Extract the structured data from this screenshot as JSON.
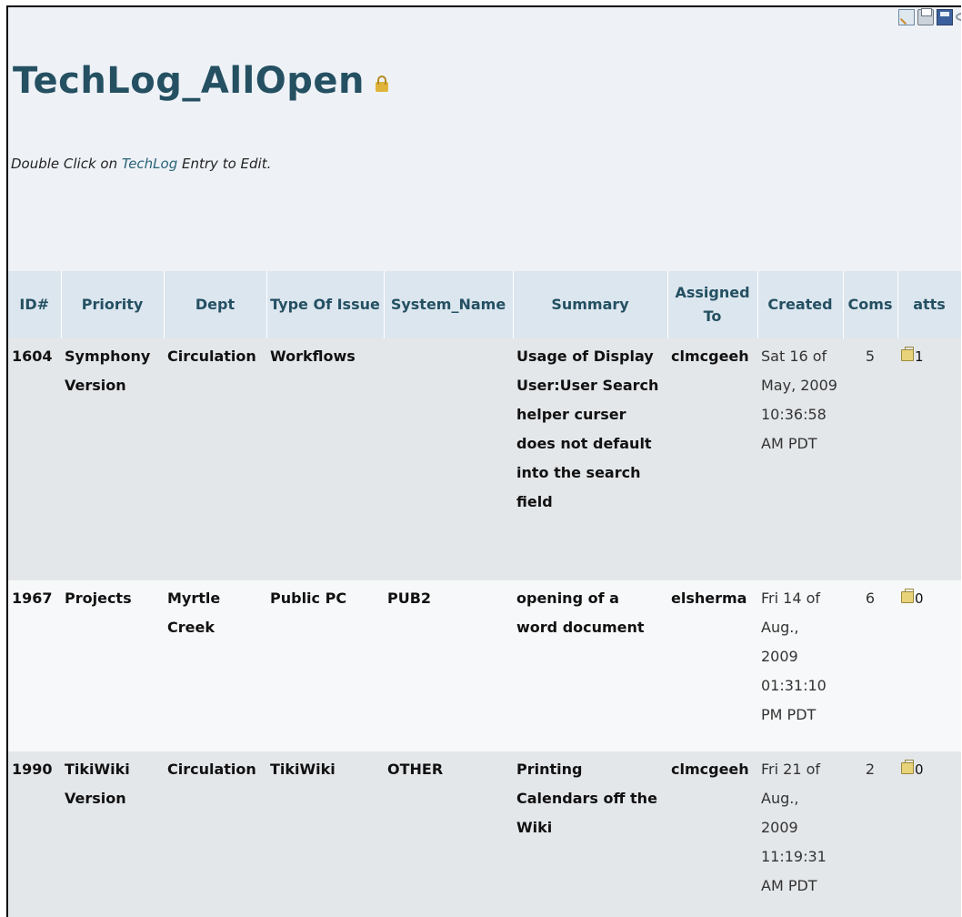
{
  "page": {
    "title": "TechLog_AllOpen",
    "instruction_prefix": "Double Click on ",
    "instruction_link": "TechLog",
    "instruction_suffix": " Entry to Edit."
  },
  "toolbar": {
    "icons": [
      "edit-icon",
      "print-icon",
      "save-icon",
      "more-icon"
    ]
  },
  "table": {
    "headers": {
      "id": "ID#",
      "priority": "Priority",
      "dept": "Dept",
      "type": "Type Of Issue",
      "system": "System_Name",
      "summary": "Summary",
      "assigned": "Assigned To",
      "created": "Created",
      "coms": "Coms",
      "atts": "atts"
    },
    "rows": [
      {
        "id": "1604",
        "priority": "Symphony Version",
        "dept": "Circulation",
        "type": "Workflows",
        "system": "",
        "summary": "Usage of Display User:User Search helper curser does not default into the search field",
        "assigned": "clmcgeeh",
        "created": "Sat 16 of May, 2009 10:36:58 AM PDT",
        "coms": "5",
        "atts": "1"
      },
      {
        "id": "1967",
        "priority": "Projects",
        "dept": "Myrtle Creek",
        "type": "Public PC",
        "system": "PUB2",
        "summary": "opening of a word document",
        "assigned": "elsherma",
        "created": "Fri 14 of Aug., 2009 01:31:10 PM PDT",
        "coms": "6",
        "atts": "0"
      },
      {
        "id": "1990",
        "priority": "TikiWiki Version",
        "dept": "Circulation",
        "type": "TikiWiki",
        "system": "OTHER",
        "summary": "Printing Calendars off the Wiki",
        "assigned": "clmcgeeh",
        "created": "Fri 21 of Aug., 2009 11:19:31 AM PDT",
        "coms": "2",
        "atts": "0"
      }
    ]
  },
  "colors": {
    "title": "#245062",
    "header_bg": "#dce6ef",
    "link": "#2a6278"
  }
}
